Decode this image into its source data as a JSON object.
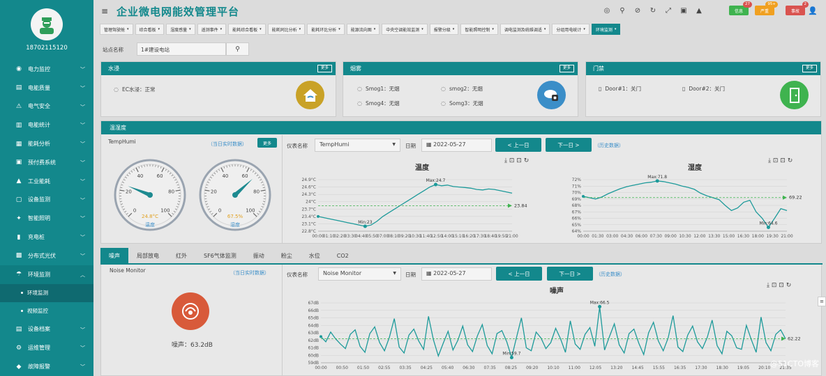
{
  "header": {
    "title": "企业微电网能效管理平台",
    "badges": [
      {
        "label": "信息",
        "count": "27",
        "color": "#3fb34f"
      },
      {
        "label": "严重",
        "count": "95+",
        "color": "#f0a020"
      },
      {
        "label": "事故",
        "count": "2",
        "color": "#d9534f"
      }
    ]
  },
  "sidebar": {
    "user": "18702115120",
    "items": [
      {
        "label": "电力监控",
        "icon": "globe-icon"
      },
      {
        "label": "电能质量",
        "icon": "chart-icon"
      },
      {
        "label": "电气安全",
        "icon": "alarm-icon"
      },
      {
        "label": "电能统计",
        "icon": "bar-icon"
      },
      {
        "label": "能耗分析",
        "icon": "analysis-icon"
      },
      {
        "label": "预付费系统",
        "icon": "wallet-icon"
      },
      {
        "label": "工业能耗",
        "icon": "factory-icon"
      },
      {
        "label": "设备监测",
        "icon": "device-icon"
      },
      {
        "label": "智能照明",
        "icon": "bulb-icon"
      },
      {
        "label": "充电桩",
        "icon": "charger-icon"
      },
      {
        "label": "分布式光伏",
        "icon": "solar-icon"
      },
      {
        "label": "环境监测",
        "icon": "env-icon"
      }
    ],
    "subitems": [
      {
        "label": "环境监测"
      },
      {
        "label": "视频监控"
      }
    ],
    "items_after": [
      {
        "label": "设备档案",
        "icon": "archive-icon"
      },
      {
        "label": "运维管理",
        "icon": "tools-icon"
      },
      {
        "label": "故障报警",
        "icon": "fault-icon"
      }
    ]
  },
  "tabs": [
    "管理驾驶舱",
    "综合看板",
    "湿度感量",
    "遥测事件",
    "能耗综合看板",
    "能耗同比分析",
    "能耗环比分析",
    "能源流向图",
    "中央空调能效监测",
    "报警分级",
    "智能照明控制",
    "调电监测及统维调适",
    "分组用电统计",
    "环境监测"
  ],
  "station": {
    "label": "站点名称",
    "value": "1#建设电站"
  },
  "water": {
    "title": "水浸",
    "more": "更多",
    "item": "EC水浸：正常"
  },
  "smoke": {
    "title": "烟雾",
    "more": "更多",
    "items": [
      "Smog1：无烟",
      "smog2：无烟",
      "Smog4：无烟",
      "Somg3：无烟"
    ]
  },
  "door": {
    "title": "门禁",
    "more": "更多",
    "items": [
      "Door#1：关门",
      "Door#2：关门"
    ]
  },
  "temphumi": {
    "title": "温湿度",
    "device": "TempHumi",
    "realtime": "（当日实时数据）",
    "more": "更多",
    "gauge_temp": {
      "value": 24.8,
      "label": "温度",
      "display": "24.8°C",
      "ticks": [
        "0",
        "20",
        "40",
        "60",
        "80",
        "100"
      ]
    },
    "gauge_humi": {
      "value": 67.5,
      "label": "湿度",
      "display": "67.5%",
      "ticks": [
        "0",
        "20",
        "40",
        "60",
        "80",
        "100"
      ]
    },
    "meter_label": "仪表名称",
    "meter_value": "TempHumi",
    "date_label": "日期",
    "date": "2022-05-27",
    "prev": "< 上一日",
    "next": "下一日 >",
    "history": "（历史数据）"
  },
  "bottom_tabs": [
    "噪声",
    "局部放电",
    "红外",
    "SF6气体监测",
    "振动",
    "粉尘",
    "水位",
    "CO2"
  ],
  "noise": {
    "device": "Noise Monitor",
    "realtime": "（当日实时数据）",
    "value": "噪声：63.2dB",
    "meter_label": "仪表名称",
    "meter_value": "Noise Monitor",
    "date_label": "日期",
    "date": "2022-05-27",
    "prev": "< 上一日",
    "next": "下一日 >",
    "history": "（历史数据）"
  },
  "watermark": "@51CTO博客",
  "chart_data": [
    {
      "type": "line",
      "title": "温度",
      "x": [
        "00:00",
        "00:40",
        "01:20",
        "02:00",
        "02:40",
        "03:20",
        "04:00",
        "04:40",
        "05:20",
        "06:00",
        "06:40",
        "07:20",
        "08:00",
        "08:40",
        "09:20",
        "10:00",
        "10:40",
        "11:20",
        "12:00",
        "12:40",
        "13:20",
        "14:00",
        "14:40",
        "15:20",
        "16:00",
        "16:40",
        "17:20",
        "18:00",
        "18:40",
        "19:20",
        "20:00",
        "20:40",
        "21:20",
        "22:00"
      ],
      "series": [
        {
          "values": [
            23.4,
            23.35,
            23.3,
            23.25,
            23.2,
            23.15,
            23.1,
            23.05,
            23.0,
            23.05,
            23.2,
            23.4,
            23.55,
            23.7,
            23.85,
            24.0,
            24.15,
            24.3,
            24.45,
            24.6,
            24.7,
            24.65,
            24.68,
            24.62,
            24.6,
            24.58,
            24.55,
            24.5,
            24.48,
            24.52,
            24.5,
            24.45,
            24.4,
            24.35
          ]
        }
      ],
      "ylim": [
        22.8,
        24.9
      ],
      "yticks": [
        "22.8°C",
        "23.1°C",
        "23.4°C",
        "23.7°C",
        "24°C",
        "24.3°C",
        "24.6°C",
        "24.9°C"
      ],
      "xticks": [
        "00:00",
        "01:10",
        "02:20",
        "03:30",
        "04:40",
        "05:50",
        "07:00",
        "08:10",
        "09:20",
        "10:30",
        "11:40",
        "12:50",
        "14:00",
        "15:10",
        "16:20",
        "17:30",
        "18:40",
        "19:50",
        "21:00"
      ],
      "max_label": "Max:24.7",
      "min_label": "Min:23",
      "avg_label": "23.84",
      "avg": 23.84
    },
    {
      "type": "line",
      "title": "湿度",
      "x": [
        "00:00",
        "00:40",
        "01:20",
        "02:00",
        "02:40",
        "03:20",
        "04:00",
        "04:40",
        "05:20",
        "06:00",
        "06:40",
        "07:20",
        "08:00",
        "08:40",
        "09:20",
        "10:00",
        "10:40",
        "11:20",
        "12:00",
        "12:40",
        "13:20",
        "14:00",
        "14:40",
        "15:20",
        "16:00",
        "16:40",
        "17:20",
        "18:00",
        "18:40",
        "19:20",
        "20:00",
        "20:40",
        "21:20",
        "22:00"
      ],
      "series": [
        {
          "values": [
            69.4,
            69.2,
            69.0,
            69.3,
            69.8,
            70.2,
            70.6,
            70.9,
            71.1,
            71.3,
            71.5,
            71.6,
            71.8,
            71.7,
            71.5,
            71.3,
            71.0,
            70.8,
            70.5,
            69.9,
            69.5,
            69.2,
            68.9,
            68.0,
            67.2,
            67.6,
            68.5,
            68.8,
            67.0,
            66.0,
            64.6,
            66.0,
            67.5,
            67.2
          ]
        }
      ],
      "ylim": [
        64,
        72
      ],
      "yticks": [
        "64%",
        "65%",
        "66%",
        "67%",
        "68%",
        "69%",
        "70%",
        "71%",
        "72%"
      ],
      "xticks": [
        "00:00",
        "01:30",
        "03:00",
        "04:30",
        "06:00",
        "07:30",
        "09:00",
        "10:30",
        "12:00",
        "13:30",
        "15:00",
        "16:30",
        "18:00",
        "19:30",
        "21:00"
      ],
      "max_label": "Max:71.8",
      "min_label": "Min:64.6",
      "avg_label": "69.22",
      "avg": 69.22
    },
    {
      "type": "line",
      "title": "噪声",
      "x_count": 96,
      "series": [
        {
          "values": [
            62.5,
            61.8,
            63.1,
            62.2,
            61.5,
            60.9,
            62.8,
            63.4,
            61.2,
            60.4,
            62.9,
            63.8,
            61.7,
            60.6,
            62.4,
            64.9,
            61.1,
            60.3,
            62.7,
            63.5,
            61.9,
            60.8,
            65.2,
            62.1,
            59.9,
            61.6,
            63.2,
            60.7,
            62.0,
            63.9,
            61.4,
            60.5,
            62.6,
            64.1,
            61.3,
            60.2,
            62.9,
            63.3,
            61.8,
            59.7,
            62.4,
            65.0,
            61.0,
            60.6,
            63.1,
            62.3,
            60.9,
            61.7,
            63.6,
            62.2,
            60.4,
            64.6,
            61.5,
            60.8,
            62.8,
            63.7,
            61.2,
            66.5,
            60.7,
            62.5,
            64.2,
            61.4,
            60.3,
            62.9,
            63.5,
            61.6,
            60.1,
            63.0,
            64.4,
            61.9,
            60.6,
            62.3,
            65.3,
            61.1,
            60.5,
            62.7,
            63.9,
            61.8,
            60.9,
            62.4,
            64.7,
            61.3,
            60.2,
            63.2,
            62.6,
            61.0,
            60.8,
            64.0,
            62.1,
            60.4,
            65.1,
            61.7,
            60.6,
            62.8,
            63.4,
            62.2
          ]
        }
      ],
      "ylim": [
        59,
        67
      ],
      "yticks": [
        "59dB",
        "60dB",
        "61dB",
        "62dB",
        "63dB",
        "64dB",
        "65dB",
        "66dB",
        "67dB"
      ],
      "xticks": [
        "00:00",
        "00:50",
        "01:50",
        "02:55",
        "03:35",
        "04:25",
        "05:40",
        "06:30",
        "07:35",
        "08:25",
        "09:20",
        "10:10",
        "11:00",
        "12:05",
        "13:20",
        "14:45",
        "15:55",
        "16:35",
        "17:30",
        "18:30",
        "19:05",
        "20:10",
        "21:35"
      ],
      "max_label": "Max:66.5",
      "min_label": "Min:59.7",
      "avg_label": "62.22",
      "avg": 62.22
    }
  ]
}
